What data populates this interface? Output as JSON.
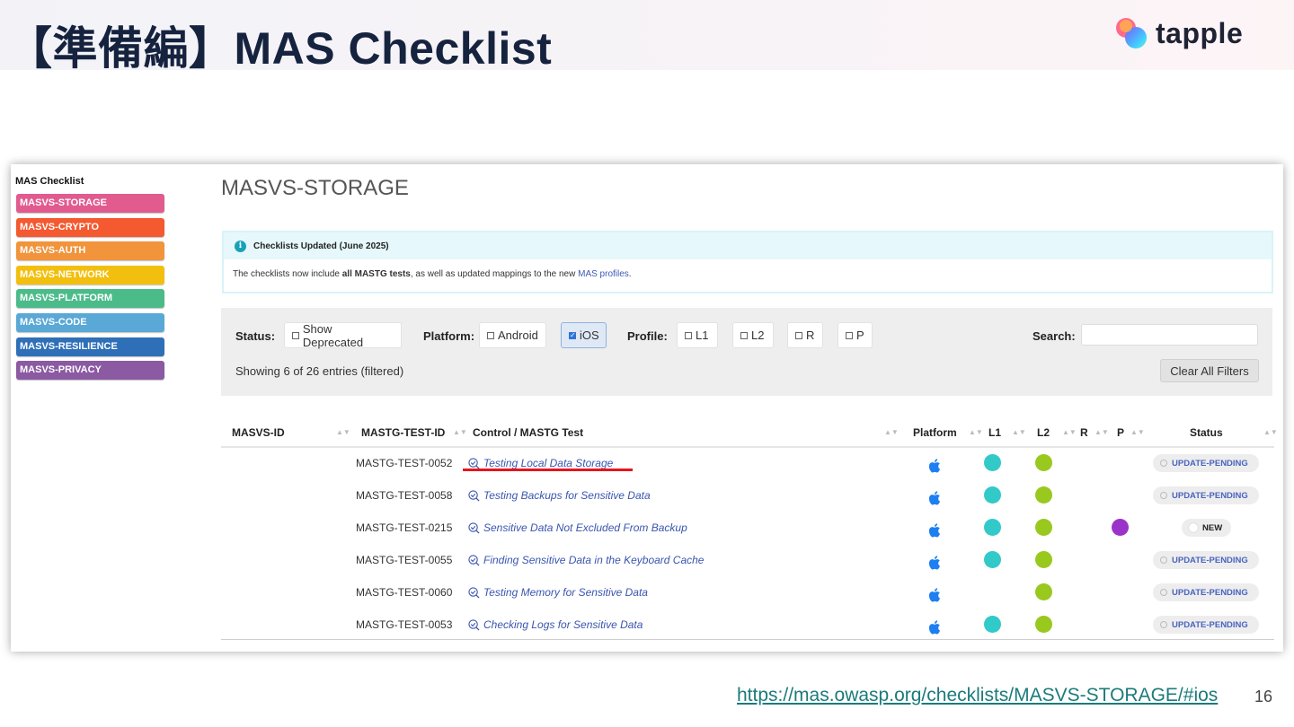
{
  "slide": {
    "title": "【準備編】MAS Checklist",
    "brand": "tapple",
    "source_url": "https://mas.owasp.org/checklists/MASVS-STORAGE/#ios",
    "page_number": "16"
  },
  "sidebar": {
    "title": "MAS Checklist",
    "items": [
      {
        "label": "MASVS-STORAGE",
        "color": "#e15b8f"
      },
      {
        "label": "MASVS-CRYPTO",
        "color": "#f4592f"
      },
      {
        "label": "MASVS-AUTH",
        "color": "#f1943c"
      },
      {
        "label": "MASVS-NETWORK",
        "color": "#f2bf0f"
      },
      {
        "label": "MASVS-PLATFORM",
        "color": "#4cbb8a"
      },
      {
        "label": "MASVS-CODE",
        "color": "#5aa8d6"
      },
      {
        "label": "MASVS-RESILIENCE",
        "color": "#2e6fb8"
      },
      {
        "label": "MASVS-PRIVACY",
        "color": "#8b5aa2"
      }
    ]
  },
  "page": {
    "title": "MASVS-STORAGE"
  },
  "alert": {
    "title": "Checklists Updated (June 2025)",
    "body_prefix": "The checklists now include ",
    "body_bold": "all MASTG tests",
    "body_mid": ", as well as updated mappings to the new ",
    "body_link": "MAS profiles",
    "body_suffix": "."
  },
  "filters": {
    "status_label": "Status:",
    "show_deprecated": "Show Deprecated",
    "platform_label": "Platform:",
    "android": "Android",
    "ios": "iOS",
    "profile_label": "Profile:",
    "l1": "L1",
    "l2": "L2",
    "r": "R",
    "p": "P",
    "search_label": "Search:",
    "search_value": "",
    "showing": "Showing 6 of 26 entries (filtered)",
    "clear_all": "Clear All Filters"
  },
  "table": {
    "headers": {
      "masvs_id": "MASVS-ID",
      "mastg_test_id": "MASTG-TEST-ID",
      "control": "Control / MASTG Test",
      "platform": "Platform",
      "l1": "L1",
      "l2": "L2",
      "r": "R",
      "p": "P",
      "status": "Status"
    },
    "rows": [
      {
        "id": "MASTG-TEST-0052",
        "test": "Testing Local Data Storage",
        "platform": "apple-icon",
        "l1": true,
        "l2": true,
        "p": false,
        "status": "UPDATE-PENDING"
      },
      {
        "id": "MASTG-TEST-0058",
        "test": "Testing Backups for Sensitive Data",
        "platform": "apple-icon",
        "l1": true,
        "l2": true,
        "p": false,
        "status": "UPDATE-PENDING"
      },
      {
        "id": "MASTG-TEST-0215",
        "test": "Sensitive Data Not Excluded From Backup",
        "platform": "apple-icon",
        "l1": true,
        "l2": true,
        "p": true,
        "status": "NEW"
      },
      {
        "id": "MASTG-TEST-0055",
        "test": "Finding Sensitive Data in the Keyboard Cache",
        "platform": "apple-icon",
        "l1": true,
        "l2": true,
        "p": false,
        "status": "UPDATE-PENDING"
      },
      {
        "id": "MASTG-TEST-0060",
        "test": "Testing Memory for Sensitive Data",
        "platform": "apple-icon",
        "l1": false,
        "l2": true,
        "p": false,
        "status": "UPDATE-PENDING"
      },
      {
        "id": "MASTG-TEST-0053",
        "test": "Checking Logs for Sensitive Data",
        "platform": "apple-icon",
        "l1": true,
        "l2": true,
        "p": false,
        "status": "UPDATE-PENDING"
      }
    ]
  },
  "colors": {
    "l1": "#32c9c9",
    "l2": "#99c81f",
    "p": "#9b33c9",
    "highlight_underline": "#e8141c"
  }
}
